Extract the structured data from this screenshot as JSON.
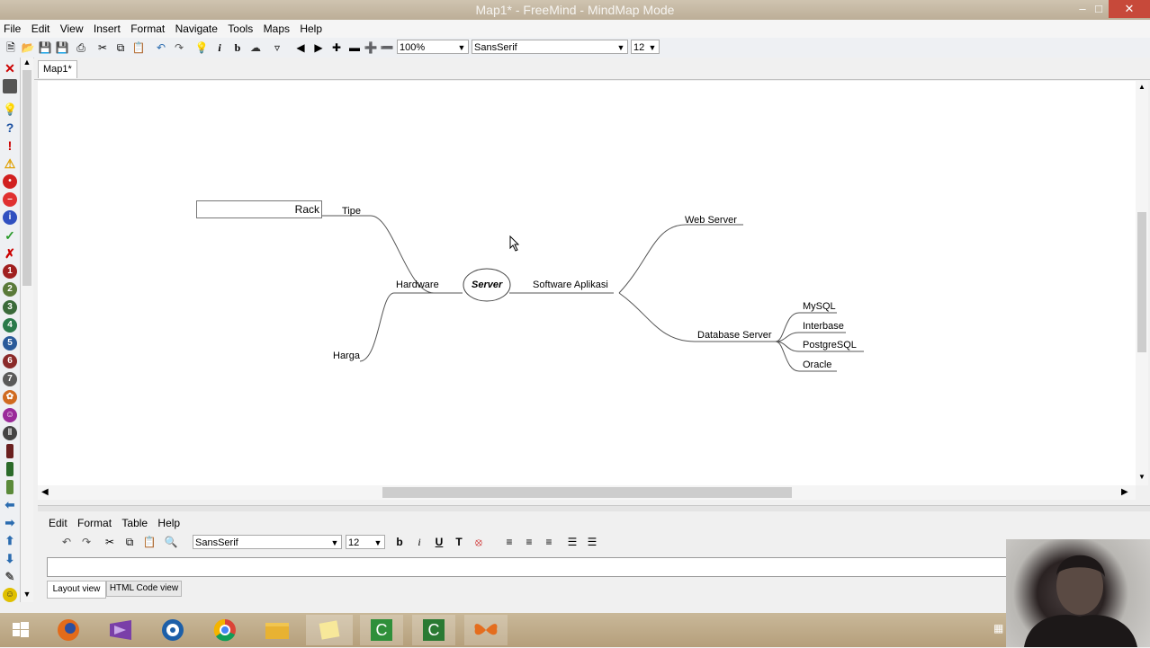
{
  "window": {
    "title": "Map1* - FreeMind - MindMap Mode"
  },
  "menubar": [
    "File",
    "Edit",
    "View",
    "Insert",
    "Format",
    "Navigate",
    "Tools",
    "Maps",
    "Help"
  ],
  "toolbar": {
    "zoom": "100%",
    "font": "SansSerif",
    "size": "12"
  },
  "tabs": [
    "Map1*"
  ],
  "mindmap": {
    "root": "Server",
    "hardware": "Hardware",
    "tipe": "Tipe",
    "rack": "Rack",
    "harga": "Harga",
    "software": "Software Aplikasi",
    "web": "Web Server",
    "database": "Database Server",
    "db_items": [
      "MySQL",
      "Interbase",
      "PostgreSQL",
      "Oracle"
    ]
  },
  "note_editor": {
    "menu": [
      "Edit",
      "Format",
      "Table",
      "Help"
    ],
    "font": "SansSerif",
    "size": "12",
    "tabs": [
      "Layout view",
      "HTML Code view"
    ]
  },
  "colors": {
    "accent_orange": "#e07a1a",
    "title_bar": "#c4b69f",
    "taskbar": "#bba584"
  }
}
